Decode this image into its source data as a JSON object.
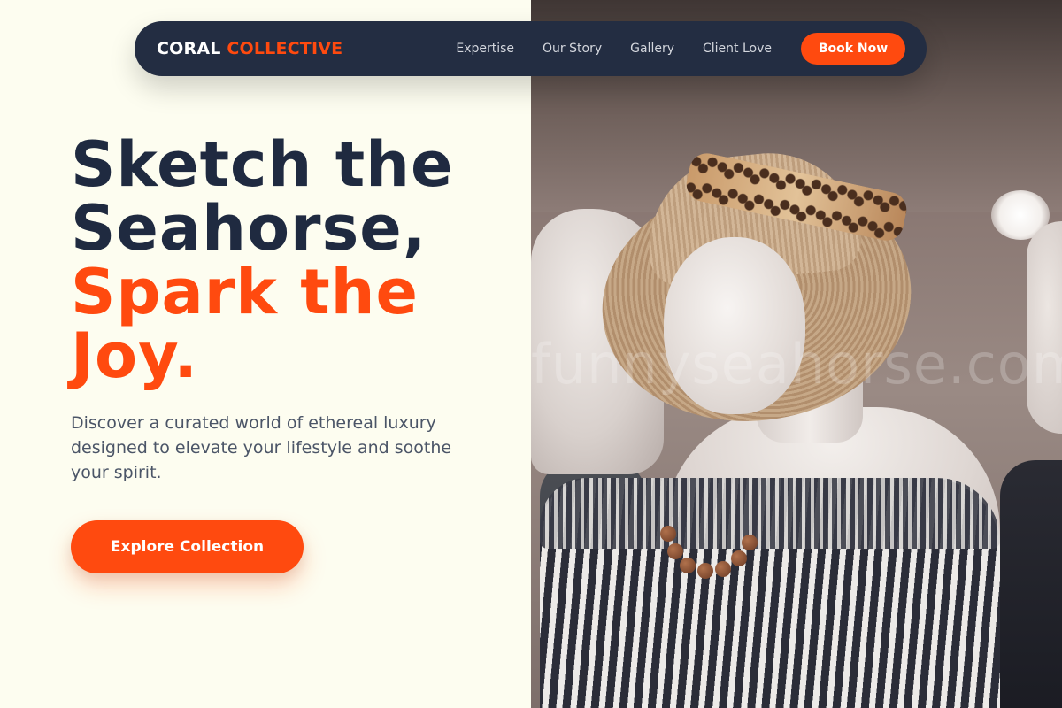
{
  "brand": {
    "part1": "CORAL",
    "part2": "COLLECTIVE"
  },
  "nav": {
    "links": [
      "Expertise",
      "Our Story",
      "Gallery",
      "Client Love"
    ],
    "cta_label": "Book Now"
  },
  "hero": {
    "title_line1": "Sketch the",
    "title_line2": "Seahorse,",
    "title_line3": "Spark the",
    "title_line4": "Joy.",
    "description": "Discover a curated world of ethereal luxury designed to elevate your lifestyle and soothe your spirit.",
    "cta_label": "Explore Collection"
  },
  "image": {
    "watermark": "funnyseahorse.com"
  },
  "colors": {
    "accent": "#ff4a0f",
    "navy": "#1f2a40",
    "background": "#fdfdf0"
  }
}
